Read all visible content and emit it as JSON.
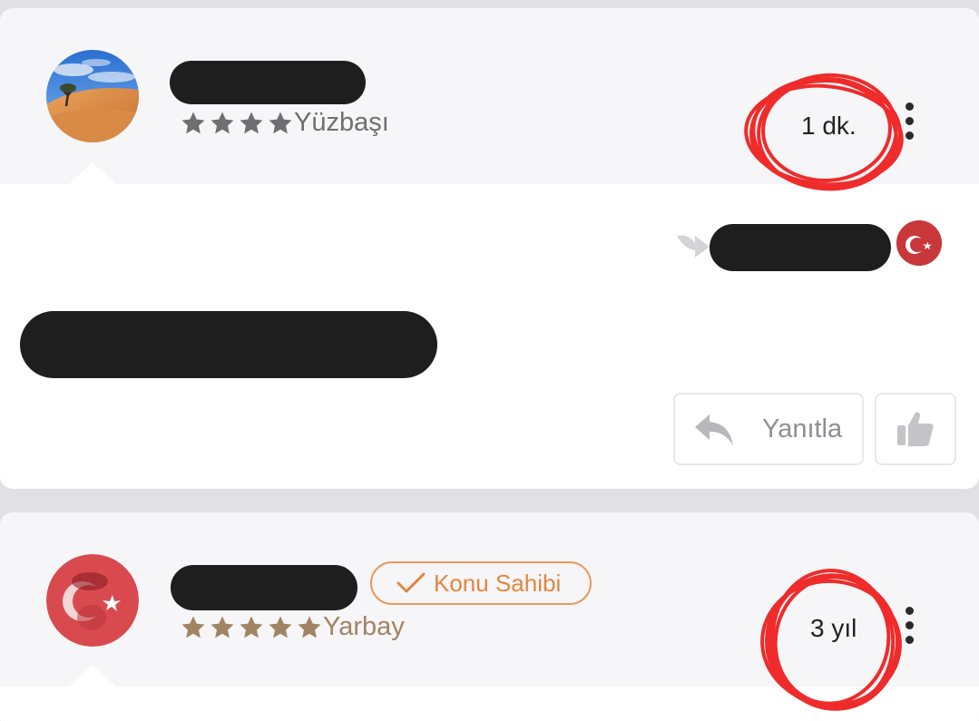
{
  "comments": [
    {
      "rank_label": "Yüzbaşı",
      "stars": 4,
      "star_color": "#6e6e73",
      "time": "1 dk.",
      "reply_label": "Yanıtla"
    },
    {
      "badge_label": "Konu Sahibi",
      "rank_label": "Yarbay",
      "stars": 5,
      "star_color": "#a18463",
      "time": "3 yıl"
    }
  ],
  "colors": {
    "badge_orange": "#e0873f",
    "annotation_red": "#ef2b2b"
  }
}
